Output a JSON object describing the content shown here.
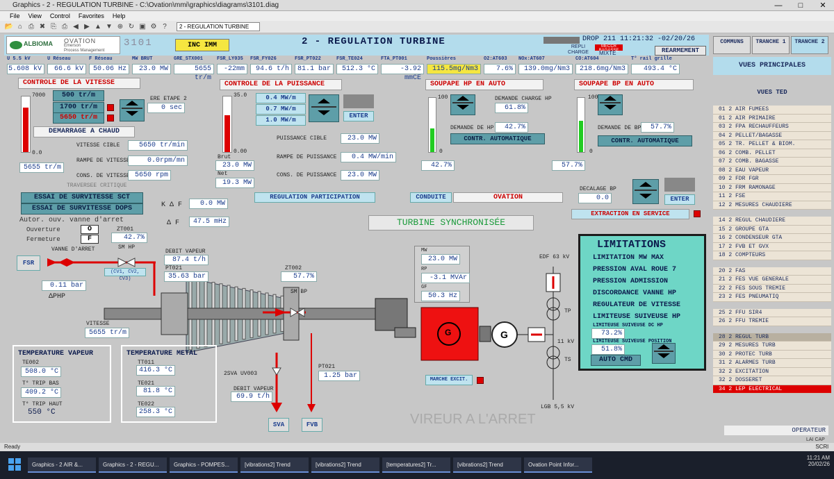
{
  "window": {
    "title": "Graphics - 2 - REGULATION TURBINE - C:\\Ovation\\mmi\\graphics\\diagrams\\3101.diag",
    "menu": [
      "File",
      "View",
      "Control",
      "Favorites",
      "Help"
    ],
    "combo": "2 - REGULATION TURBINE"
  },
  "header": {
    "logo_text": "ALBIOMA",
    "logo_sub": "OVATION",
    "logo_sub2": "Emerson",
    "logo_sub3": "Process Management",
    "diagram_no": "3101",
    "inc_button": "INC IMM",
    "title": "2 - REGULATION TURBINE",
    "drop_time": "DROP 211 11:21:32 -02/20/26",
    "repli_charge": "REPLI CHARGE",
    "mode_a": "MECCR BAGASSE",
    "mode_b": "MIXTE",
    "rearm_button": "REARMEMENT"
  },
  "measures": [
    {
      "label": "U 5.5 kV",
      "value": "5.608 kV"
    },
    {
      "label": "U Réseau",
      "value": "66.6 kV"
    },
    {
      "label": "F Réseau",
      "value": "50.06 Hz"
    },
    {
      "label": "MW BRUT",
      "value": "23.0 MW"
    },
    {
      "label": "GRE_STX001",
      "value": "5655 tr/m"
    },
    {
      "label": "FSR_LY035",
      "value": "-22mm"
    },
    {
      "label": "FSR_FY026",
      "value": "94.6 t/h"
    },
    {
      "label": "FSR_PT022",
      "value": "81.1 bar"
    },
    {
      "label": "FSR_TE024",
      "value": "512.3 °C"
    },
    {
      "label": "FTA_PT001",
      "value": "-3.92 mmCE"
    },
    {
      "label": "Poussières",
      "value": "115.5mg/Nm3"
    },
    {
      "label": "O2:AT603",
      "value": "7.6%"
    },
    {
      "label": "NOx:AT607",
      "value": "139.0mg/Nm3"
    },
    {
      "label": "CO:AT604",
      "value": "218.6mg/Nm3"
    },
    {
      "label": "T° rail grille",
      "value": "493.4 °C"
    }
  ],
  "vitesse": {
    "section": "CONTROLE DE LA VITESSE",
    "scale_max": "7000",
    "scale_min": "0.0",
    "speed_fill": 0.8,
    "sp1": "500 tr/m",
    "sp2": "1700 tr/m",
    "sp3": "5650 tr/m",
    "ere_etape_label": "ERE ETAPE 2",
    "ere_etape_value": "0 sec",
    "demarrage": "DEMARRAGE A CHAUD",
    "speed_value": "5655 tr/m",
    "cible_label": "VITESSE CIBLE",
    "cible_value": "5650 tr/min",
    "rampe_label": "RAMPE DE VITESSE",
    "rampe_value": "0.0rpm/mn",
    "cons_label": "CONS. DE VITESSE",
    "cons_value": "5650 rpm",
    "traversee": "TRAVERSEE CRITIQUE",
    "essai_sct": "ESSAI DE SURVITESSE SCT",
    "essai_dops": "ESSAI DE SURVITESSE DOPS",
    "autor": "Autor. ouv. vanne d'arret",
    "ouverture": "Ouverture",
    "fermeture": "Fermeture",
    "o_btn": "O",
    "f_btn": "F"
  },
  "puissance": {
    "section": "CONTROLE DE LA PUISSANCE",
    "scale_max": "35.0",
    "scale_min": "0.00",
    "power_fill": 0.66,
    "sp1": "0.4 MW/m",
    "sp2": "0.7 MW/m",
    "sp3": "1.0 MW/m",
    "enter": "ENTER",
    "brut_label": "Brut",
    "brut_value": "23.0 MW",
    "net_label": "Net",
    "net_value": "19.3 MW",
    "cible_label": "PUISSANCE CIBLE",
    "cible_value": "23.0 MW",
    "rampe_label": "RAMPE DE PUISSANCE",
    "rampe_value": "0.4 MW/min",
    "cons_label": "CONS. DE PUISSANCE",
    "cons_value": "23.0 MW",
    "participation": "REGULATION PARTICIPATION",
    "kdf_label": "K Δ F",
    "kdf_value": "0.0 MW",
    "df_label": "Δ F",
    "df_value": "47.5 mHz"
  },
  "soupape_hp": {
    "section": "SOUPAPE HP EN AUTO",
    "scale_max": "100",
    "scale_min": "0",
    "fill": 0.43,
    "demande_charge_label": "DEMANDE CHARGE HP",
    "demande_charge_value": "61.8%",
    "demande_label": "DEMANDE DE HP",
    "demande_value": "42.7%",
    "contr": "CONTR. AUTOMATIQUE",
    "pos_value": "42.7%"
  },
  "soupape_bp": {
    "section": "SOUPAPE BP EN AUTO",
    "scale_max": "100",
    "scale_min": "0",
    "fill": 0.58,
    "demande_label": "DEMANDE DE BP",
    "demande_value": "57.7%",
    "contr": "CONTR. AUTOMATIQUE",
    "pos_value": "57.7%",
    "decalage_label": "DECALAGE BP",
    "decalage_value": "0.0",
    "enter": "ENTER",
    "extraction": "EXTRACTION EN SERVICE"
  },
  "conduite": {
    "label": "CONDUITE",
    "value": "OVATION"
  },
  "status": "TURBINE SYNCHRONISÉE",
  "process": {
    "fsr": "FSR",
    "vanne_arret": "VANNE D'ARRET",
    "dphp_value": "0.11 bar",
    "dphp_label": "ΔPHP",
    "sm_hp": "SM HP",
    "cv_label": "(CV1, CV2, CV3)",
    "zt001_label": "ZT001",
    "zt001_value": "42.7%",
    "debit_label": "DEBIT VAPEUR",
    "debit_value": "87.4 t/h",
    "pt021_label": "PT021",
    "pt021_value": "35.63 bar",
    "zt002_label": "ZT002",
    "zt002_value": "57.7%",
    "sm_bp": "SM BP",
    "vitesse_label": "VITESSE",
    "vitesse_value": "5655 tr/m",
    "mw_label": "MW",
    "mw_value": "23.0 MW",
    "rp_label": "RP",
    "rp_value": "-3.1 MVAr",
    "gf_label": "GF",
    "gf_value": "50.3 Hz",
    "gen": "G",
    "gen2": "G",
    "sva_label": "2SVA UV003",
    "debit2_label": "DEBIT VAPEUR",
    "debit2_value": "69.9 t/h",
    "pt021b_label": "PT021",
    "pt021b_value": "1.25 bar",
    "marche_excit": "MARCHE EXCIT.",
    "viru": "VIREUR A L'ARRET",
    "sva_btn": "SVA",
    "fvb_btn": "FVB",
    "edf": "EDF 63 kV",
    "tp": "TP",
    "kv11": "11 kV",
    "ts": "TS",
    "lgb": "LGB 5,5 kV"
  },
  "temp_vapeur": {
    "title": "TEMPERATURE VAPEUR",
    "te002_label": "TE002",
    "te002_value": "508.0 °C",
    "trip_bas_label": "T° TRIP BAS",
    "trip_bas_value": "409.2 °C",
    "trip_haut_label": "T° TRIP HAUT",
    "trip_haut_value": "550 °C"
  },
  "temp_metal": {
    "title": "TEMPERATURE METAL",
    "tt011_label": "TT011",
    "tt011_value": "416.3 °C",
    "te021_label": "TE021",
    "te021_value": "81.8 °C",
    "te022_label": "TE022",
    "te022_value": "258.3 °C"
  },
  "limitations": {
    "title": "LIMITATIONS",
    "items": [
      "LIMITATION MW MAX",
      "PRESSION AVAL ROUE 7",
      "PRESSION ADMISSION",
      "DISCORDANCE VANNE HP",
      "REGULATEUR DE VITESSE",
      "LIMITEUSE SUIVEUSE HP"
    ],
    "dc_label": "LIMITEUSE SUIVEUSE DC HP",
    "dc_value": "73.2%",
    "pos_label": "LIMITEUSE SUIVEUSE POSITION",
    "pos_value": "51.8%",
    "auto_cmd": "AUTO CMD"
  },
  "right": {
    "tabs": [
      "COMMUNS",
      "TRANCHE 1",
      "TRANCHE 2"
    ],
    "vues_principales": "VUES PRINCIPALES",
    "vues_ted": "VUES TED",
    "group1": [
      "01 2 AIR FUMEES",
      "01 2 AIR PRIMAIRE",
      "03 2 FPA RECHAUFFEURS",
      "04 2 PELLET/BAGASSE",
      "05 2 TR. PELLET & BIOM.",
      "06 2 COMB. PELLET",
      "07 2 COMB. BAGASSE",
      "08 2 EAU VAPEUR",
      "09 2 FDR FGR",
      "10 2 FRM RAMONAGE",
      "11 2 FSE",
      "12 2 MESURES CHAUDIERE"
    ],
    "group2": [
      "14 2 REGUL CHAUDIERE",
      "15 2 GROUPE GTA",
      "16 2 CONDENSEUR GTA",
      "17 2 FVB ET GVX",
      "18 2 COMPTEURS"
    ],
    "group3": [
      "20 2 FAS",
      "21 2 FES VUE GENERALE",
      "22 2 FES SOUS TREMIE",
      "23 2 FES PNEUMATIQ"
    ],
    "group4": [
      "25 2 FFU SIR4",
      "26 2 FFU TREMIE"
    ],
    "group5": [
      "28 2 REGUL TURB",
      "29 2 MESURES TURB",
      "30 2 PROTEC TURB",
      "31 2 ALARMES TURB",
      "32 2 EXCITATION",
      "32 2 DOSSERET",
      "34 2 LEP ELECTRICAL"
    ],
    "operator": "OPERATEUR",
    "lai_cap": "LAI CAP"
  },
  "statusbar": {
    "text": "Ready",
    "scr": "SCRl"
  },
  "taskbar": {
    "items": [
      "Graphics - 2 AIR &...",
      "Graphics - 2 - REGU...",
      "Graphics - POMPES...",
      "[vibrations2] Trend",
      "[vibrations2] Trend",
      "[temperatures2] Tr...",
      "[vibrations2] Trend",
      "Ovation Point Infor..."
    ],
    "time": "11:21 AM",
    "date": "20/02/26"
  },
  "colors": {
    "panel": "#c7c7c7",
    "teal": "#5e9ea8",
    "limit_bg": "#6ed6c6",
    "alarm": "#d00000",
    "header": "#b3dcec",
    "poussieres": "#f5e640"
  }
}
